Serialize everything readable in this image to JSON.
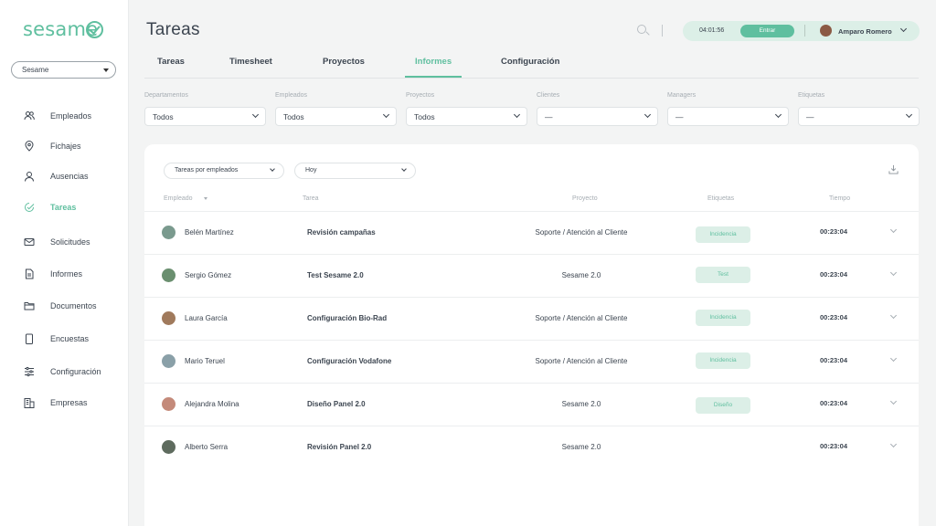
{
  "app": {
    "logo_text": "sesame"
  },
  "sidebar": {
    "company": "Sesame",
    "items": [
      {
        "label": "Empleados",
        "icon": "users-icon"
      },
      {
        "label": "Fichajes",
        "icon": "location-pin-icon"
      },
      {
        "label": "Ausencias",
        "icon": "user-absence-icon"
      },
      {
        "label": "Tareas",
        "icon": "tasks-icon"
      },
      {
        "label": "Solicitudes",
        "icon": "envelope-icon"
      },
      {
        "label": "Informes",
        "icon": "document-icon"
      },
      {
        "label": "Documentos",
        "icon": "folder-icon"
      },
      {
        "label": "Encuestas",
        "icon": "clipboard-icon"
      },
      {
        "label": "Configuración",
        "icon": "sliders-icon"
      },
      {
        "label": "Empresas",
        "icon": "building-icon"
      }
    ],
    "active": "Tareas"
  },
  "header": {
    "title": "Tareas",
    "clock_time": "04:01:56",
    "clock_button": "Entrar",
    "user_name": "Amparo Romero"
  },
  "tabs": [
    "Tareas",
    "Timesheet",
    "Proyectos",
    "Informes",
    "Configuración"
  ],
  "active_tab": "Informes",
  "filters": [
    {
      "label": "Departamentos",
      "value": "Todos"
    },
    {
      "label": "Empleados",
      "value": "Todos"
    },
    {
      "label": "Proyectos",
      "value": "Todos"
    },
    {
      "label": "Clientes",
      "value": "—"
    },
    {
      "label": "Managers",
      "value": "—"
    },
    {
      "label": "Etiquetas",
      "value": "—"
    }
  ],
  "report": {
    "group_by": "Tareas por empleados",
    "period": "Hoy",
    "columns": [
      "Empleado",
      "Tarea",
      "Proyecto",
      "Etiquetas",
      "Tiempo"
    ],
    "rows": [
      {
        "employee": "Belén Martínez",
        "task": "Revisión campañas",
        "project": "Soporte / Atención al Cliente",
        "tag": "Incidencia",
        "time": "00:23:04"
      },
      {
        "employee": "Sergio Gómez",
        "task": "Test Sesame 2.0",
        "project": "Sesame 2.0",
        "tag": "Test",
        "time": "00:23:04"
      },
      {
        "employee": "Laura García",
        "task": "Configuración Bio-Rad",
        "project": "Soporte / Atención al Cliente",
        "tag": "Incidencia",
        "time": "00:23:04"
      },
      {
        "employee": "Mario Teruel",
        "task": "Configuración Vodafone",
        "project": "Soporte / Atención al Cliente",
        "tag": "Incidencia",
        "time": "00:23:04"
      },
      {
        "employee": "Alejandra Molina",
        "task": "Diseño Panel 2.0",
        "project": "Sesame 2.0",
        "tag": "Diseño",
        "time": "00:23:04"
      },
      {
        "employee": "Alberto Serra",
        "task": "Revisión Panel 2.0",
        "project": "Sesame 2.0",
        "tag": "",
        "time": "00:23:04"
      }
    ]
  },
  "colors": {
    "accent": "#5fbf9f",
    "accent_light": "#dcefe7",
    "text": "#3c4550",
    "muted": "#a6adb3"
  }
}
